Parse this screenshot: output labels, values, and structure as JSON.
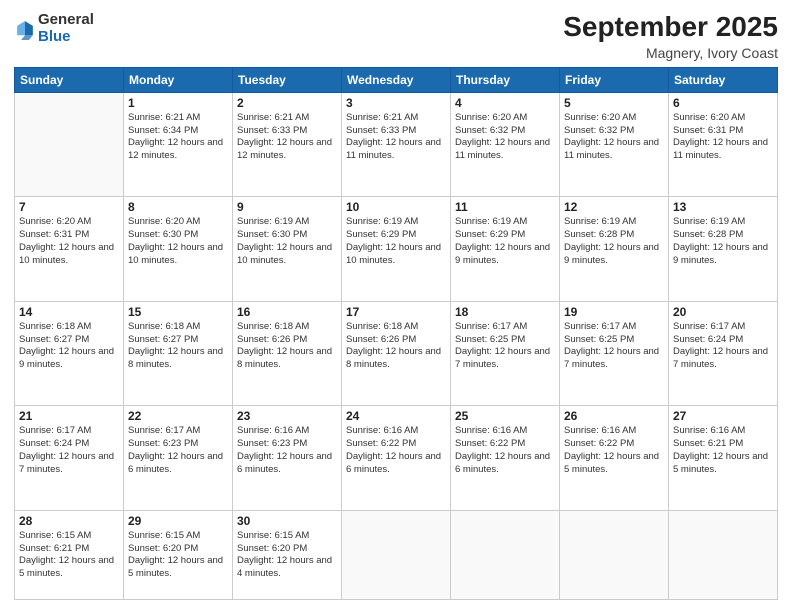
{
  "header": {
    "logo": {
      "line1": "General",
      "line2": "Blue"
    },
    "title": "September 2025",
    "subtitle": "Magnery, Ivory Coast"
  },
  "days_of_week": [
    "Sunday",
    "Monday",
    "Tuesday",
    "Wednesday",
    "Thursday",
    "Friday",
    "Saturday"
  ],
  "weeks": [
    [
      {
        "day": "",
        "info": ""
      },
      {
        "day": "1",
        "info": "Sunrise: 6:21 AM\nSunset: 6:34 PM\nDaylight: 12 hours\nand 12 minutes."
      },
      {
        "day": "2",
        "info": "Sunrise: 6:21 AM\nSunset: 6:33 PM\nDaylight: 12 hours\nand 12 minutes."
      },
      {
        "day": "3",
        "info": "Sunrise: 6:21 AM\nSunset: 6:33 PM\nDaylight: 12 hours\nand 11 minutes."
      },
      {
        "day": "4",
        "info": "Sunrise: 6:20 AM\nSunset: 6:32 PM\nDaylight: 12 hours\nand 11 minutes."
      },
      {
        "day": "5",
        "info": "Sunrise: 6:20 AM\nSunset: 6:32 PM\nDaylight: 12 hours\nand 11 minutes."
      },
      {
        "day": "6",
        "info": "Sunrise: 6:20 AM\nSunset: 6:31 PM\nDaylight: 12 hours\nand 11 minutes."
      }
    ],
    [
      {
        "day": "7",
        "info": "Sunrise: 6:20 AM\nSunset: 6:31 PM\nDaylight: 12 hours\nand 10 minutes."
      },
      {
        "day": "8",
        "info": "Sunrise: 6:20 AM\nSunset: 6:30 PM\nDaylight: 12 hours\nand 10 minutes."
      },
      {
        "day": "9",
        "info": "Sunrise: 6:19 AM\nSunset: 6:30 PM\nDaylight: 12 hours\nand 10 minutes."
      },
      {
        "day": "10",
        "info": "Sunrise: 6:19 AM\nSunset: 6:29 PM\nDaylight: 12 hours\nand 10 minutes."
      },
      {
        "day": "11",
        "info": "Sunrise: 6:19 AM\nSunset: 6:29 PM\nDaylight: 12 hours\nand 9 minutes."
      },
      {
        "day": "12",
        "info": "Sunrise: 6:19 AM\nSunset: 6:28 PM\nDaylight: 12 hours\nand 9 minutes."
      },
      {
        "day": "13",
        "info": "Sunrise: 6:19 AM\nSunset: 6:28 PM\nDaylight: 12 hours\nand 9 minutes."
      }
    ],
    [
      {
        "day": "14",
        "info": "Sunrise: 6:18 AM\nSunset: 6:27 PM\nDaylight: 12 hours\nand 9 minutes."
      },
      {
        "day": "15",
        "info": "Sunrise: 6:18 AM\nSunset: 6:27 PM\nDaylight: 12 hours\nand 8 minutes."
      },
      {
        "day": "16",
        "info": "Sunrise: 6:18 AM\nSunset: 6:26 PM\nDaylight: 12 hours\nand 8 minutes."
      },
      {
        "day": "17",
        "info": "Sunrise: 6:18 AM\nSunset: 6:26 PM\nDaylight: 12 hours\nand 8 minutes."
      },
      {
        "day": "18",
        "info": "Sunrise: 6:17 AM\nSunset: 6:25 PM\nDaylight: 12 hours\nand 7 minutes."
      },
      {
        "day": "19",
        "info": "Sunrise: 6:17 AM\nSunset: 6:25 PM\nDaylight: 12 hours\nand 7 minutes."
      },
      {
        "day": "20",
        "info": "Sunrise: 6:17 AM\nSunset: 6:24 PM\nDaylight: 12 hours\nand 7 minutes."
      }
    ],
    [
      {
        "day": "21",
        "info": "Sunrise: 6:17 AM\nSunset: 6:24 PM\nDaylight: 12 hours\nand 7 minutes."
      },
      {
        "day": "22",
        "info": "Sunrise: 6:17 AM\nSunset: 6:23 PM\nDaylight: 12 hours\nand 6 minutes."
      },
      {
        "day": "23",
        "info": "Sunrise: 6:16 AM\nSunset: 6:23 PM\nDaylight: 12 hours\nand 6 minutes."
      },
      {
        "day": "24",
        "info": "Sunrise: 6:16 AM\nSunset: 6:22 PM\nDaylight: 12 hours\nand 6 minutes."
      },
      {
        "day": "25",
        "info": "Sunrise: 6:16 AM\nSunset: 6:22 PM\nDaylight: 12 hours\nand 6 minutes."
      },
      {
        "day": "26",
        "info": "Sunrise: 6:16 AM\nSunset: 6:22 PM\nDaylight: 12 hours\nand 5 minutes."
      },
      {
        "day": "27",
        "info": "Sunrise: 6:16 AM\nSunset: 6:21 PM\nDaylight: 12 hours\nand 5 minutes."
      }
    ],
    [
      {
        "day": "28",
        "info": "Sunrise: 6:15 AM\nSunset: 6:21 PM\nDaylight: 12 hours\nand 5 minutes."
      },
      {
        "day": "29",
        "info": "Sunrise: 6:15 AM\nSunset: 6:20 PM\nDaylight: 12 hours\nand 5 minutes."
      },
      {
        "day": "30",
        "info": "Sunrise: 6:15 AM\nSunset: 6:20 PM\nDaylight: 12 hours\nand 4 minutes."
      },
      {
        "day": "",
        "info": ""
      },
      {
        "day": "",
        "info": ""
      },
      {
        "day": "",
        "info": ""
      },
      {
        "day": "",
        "info": ""
      }
    ]
  ]
}
